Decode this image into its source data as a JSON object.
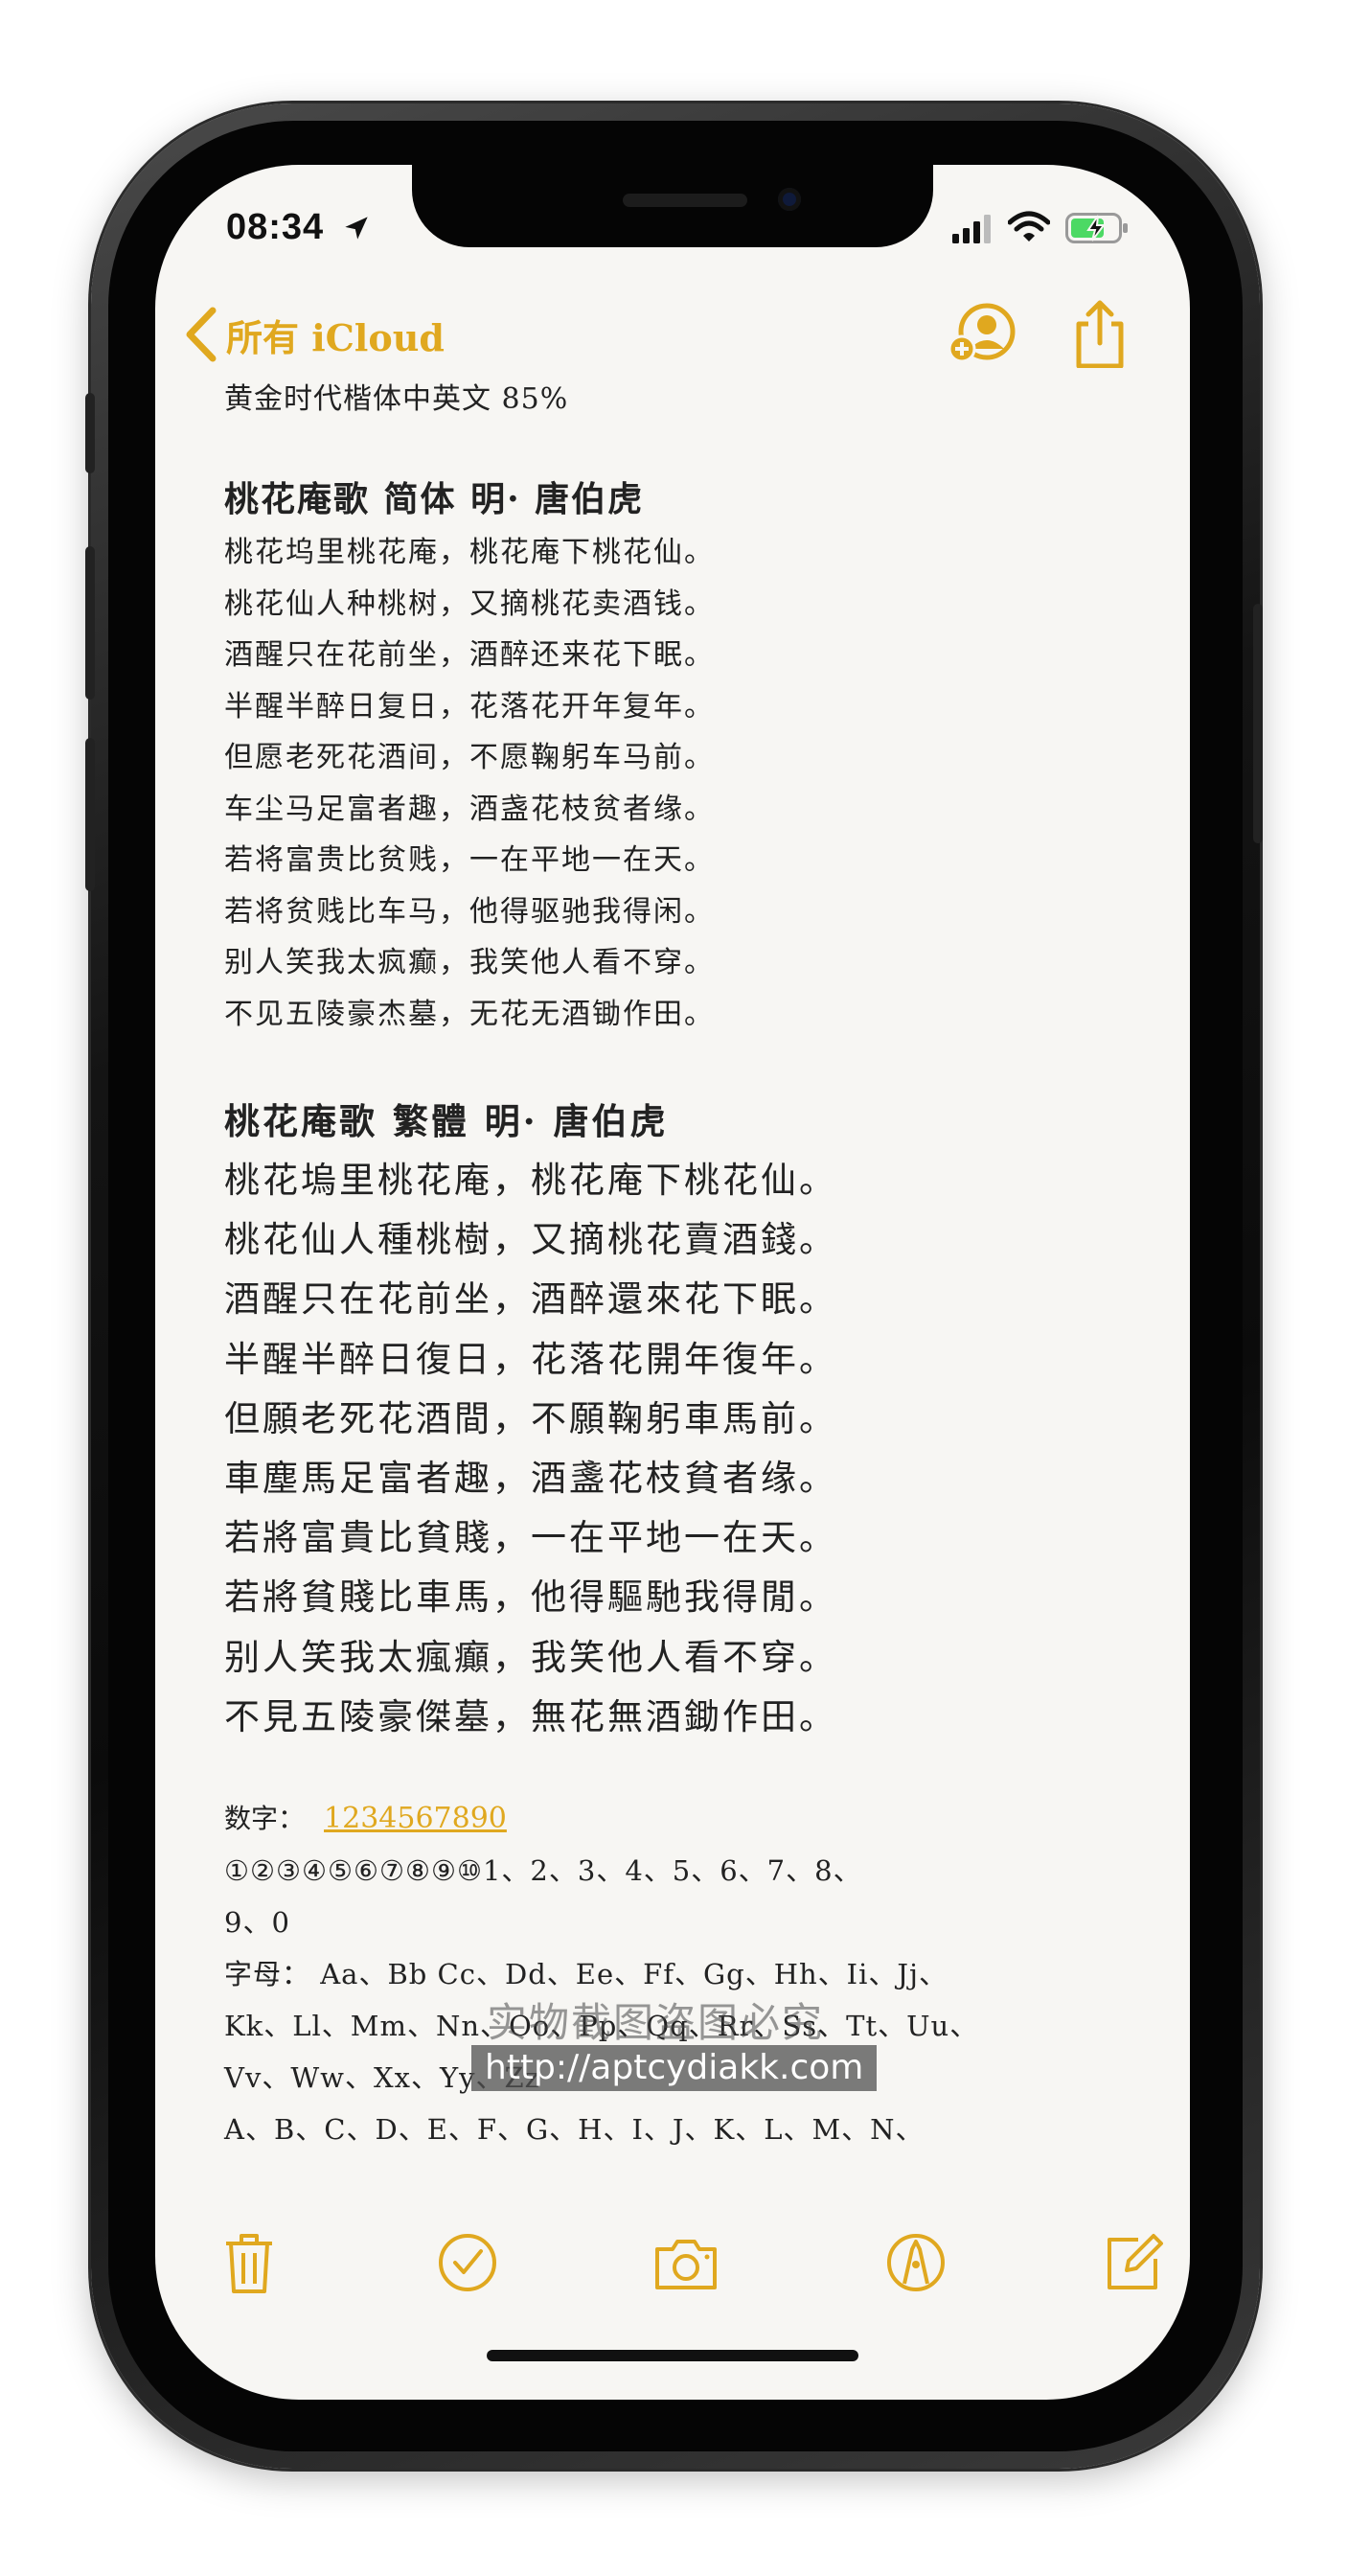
{
  "status_bar": {
    "time": "08:34"
  },
  "nav": {
    "back_label": "所有 iCloud"
  },
  "note": {
    "title": "黄金时代楷体中英文 85%",
    "simplified": {
      "heading": "桃花庵歌 简体 明· 唐伯虎",
      "lines": [
        "桃花坞里桃花庵，桃花庵下桃花仙。",
        "桃花仙人种桃树，又摘桃花卖酒钱。",
        "酒醒只在花前坐，酒醉还来花下眠。",
        "半醒半醉日复日，花落花开年复年。",
        "但愿老死花酒间，不愿鞠躬车马前。",
        "车尘马足富者趣，酒盏花枝贫者缘。",
        "若将富贵比贫贱，一在平地一在天。",
        "若将贫贱比车马，他得驱驰我得闲。",
        "别人笑我太疯癫，我笑他人看不穿。",
        "不见五陵豪杰墓，无花无酒锄作田。"
      ]
    },
    "traditional": {
      "heading": "桃花庵歌 繁體  明· 唐伯虎",
      "lines": [
        "桃花塢里桃花庵，桃花庵下桃花仙。",
        "桃花仙人種桃樹，又摘桃花賣酒錢。",
        "酒醒只在花前坐，酒醉還來花下眠。",
        "半醒半醉日復日，花落花開年復年。",
        "但願老死花酒間，不願鞠躬車馬前。",
        "車塵馬足富者趣，酒盞花枝貧者缘。",
        "若將富貴比貧賤，一在平地一在天。",
        "若將貧賤比車馬，他得驅馳我得閒。",
        "别人笑我太瘋癲，我笑他人看不穿。",
        "不見五陵豪傑墓，無花無酒鋤作田。"
      ]
    },
    "digits_label": "数字：",
    "digits_link": "1234567890",
    "digit_lines": [
      "①②③④⑤⑥⑦⑧⑨⑩1、2、3、4、5、6、7、8、",
      "9、0"
    ],
    "letter_lines": [
      "字母： Aa、Bb Cc、Dd、Ee、Ff、Gg、Hh、Ii、Jj、",
      "Kk、Ll、Mm、Nn、Oo、Pp、Qq、Rr、Ss、Tt、Uu、",
      "Vv、Ww、Xx、Yy、Zz",
      "A、B、C、D、E、F、G、H、I、J、K、L、M、N、"
    ]
  },
  "watermark": {
    "line1": "实物截图盗图必究",
    "line2": "http://aptcydiakk.com"
  },
  "colors": {
    "accent": "#e0a81f",
    "paper": "#f7f6f3",
    "text": "#222222"
  }
}
